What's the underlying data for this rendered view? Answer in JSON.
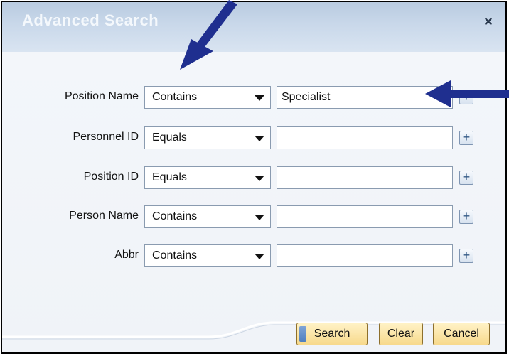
{
  "dialog": {
    "title": "Advanced Search",
    "close_label": "×"
  },
  "rows": [
    {
      "label": "Position Name",
      "operator": "Contains",
      "value": "Specialist",
      "add_label": "+"
    },
    {
      "label": "Personnel ID",
      "operator": "Equals",
      "value": "",
      "add_label": "+"
    },
    {
      "label": "Position ID",
      "operator": "Equals",
      "value": "",
      "add_label": "+"
    },
    {
      "label": "Person Name",
      "operator": "Contains",
      "value": "",
      "add_label": "+"
    },
    {
      "label": "Abbr",
      "operator": "Contains",
      "value": "",
      "add_label": "+"
    }
  ],
  "buttons": {
    "search": "Search",
    "clear": "Clear",
    "cancel": "Cancel"
  },
  "colors": {
    "annotation_arrow": "#1f2f8f",
    "button_gold": "#f7d98c",
    "title_bar": "#c9d8ea"
  }
}
